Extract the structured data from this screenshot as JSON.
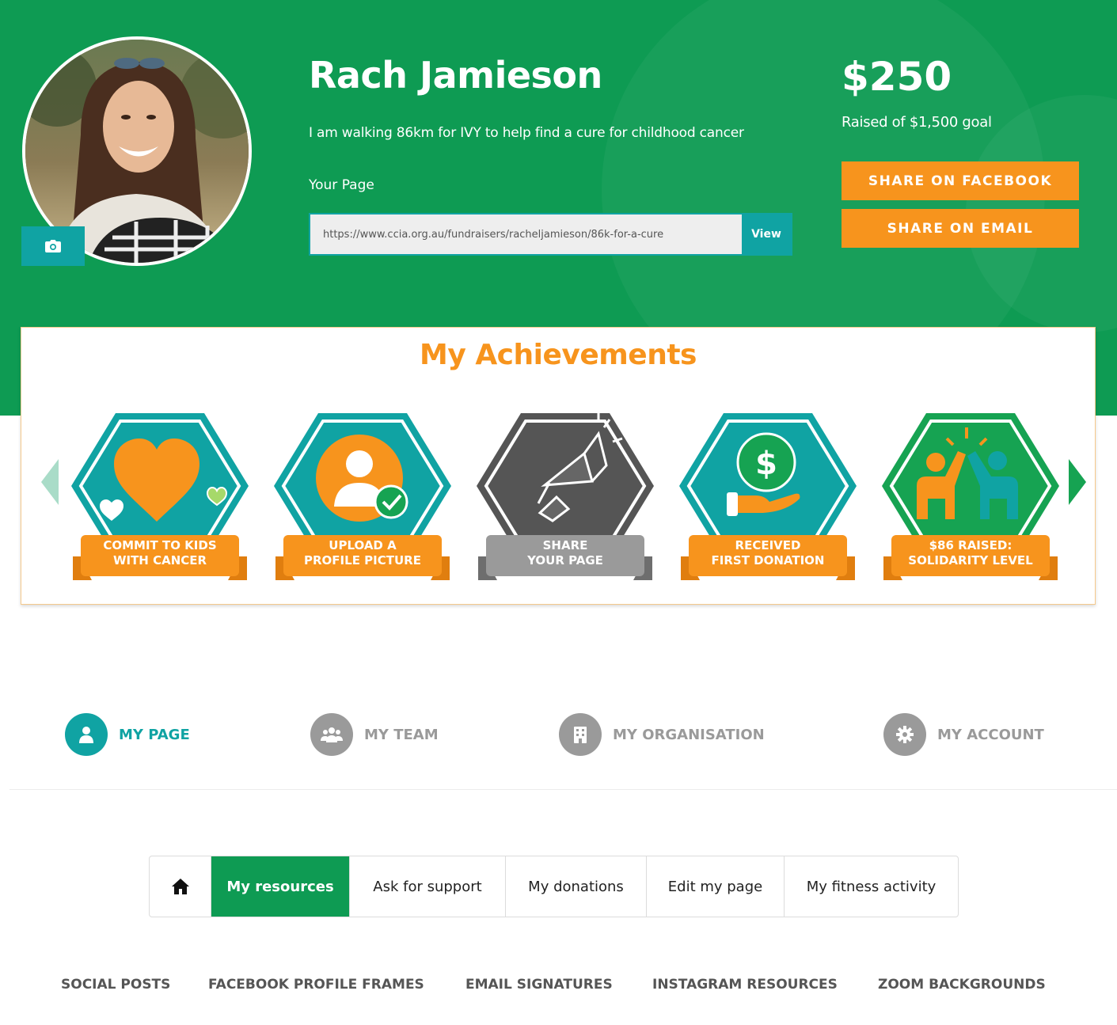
{
  "profile": {
    "name": "Rach Jamieson",
    "tagline": "I am walking 86km for IVY to help find a cure for childhood cancer",
    "your_page_label": "Your Page",
    "page_url": "https://www.ccia.org.au/fundraisers/racheljamieson/86k-for-a-cure",
    "view_label": "View"
  },
  "fundraising": {
    "raised": "$250",
    "goal_text": "Raised of $1,500 goal",
    "raised_fraction": 0.1667,
    "share_facebook_label": "SHARE ON FACEBOOK",
    "share_email_label": "SHARE ON EMAIL"
  },
  "achievements": {
    "title": "My Achievements",
    "badges": [
      {
        "line1": "COMMIT TO KIDS",
        "line2": "WITH CANCER",
        "icon": "heart-icon",
        "color": "#10a3a3",
        "achieved": true
      },
      {
        "line1": "UPLOAD A",
        "line2": "PROFILE PICTURE",
        "icon": "profile-check-icon",
        "color": "#10a3a3",
        "achieved": true
      },
      {
        "line1": "SHARE",
        "line2": "YOUR PAGE",
        "icon": "megaphone-icon",
        "color": "#555555",
        "achieved": false
      },
      {
        "line1": "RECEIVED",
        "line2": "FIRST DONATION",
        "icon": "dollar-hand-icon",
        "color": "#10a3a3",
        "achieved": true
      },
      {
        "line1": "$86 RAISED:",
        "line2": "SOLIDARITY LEVEL",
        "icon": "high-five-icon",
        "color": "#16a352",
        "achieved": true
      }
    ]
  },
  "dashboard_nav": [
    {
      "label": "MY PAGE",
      "icon": "person-icon",
      "active": true
    },
    {
      "label": "MY TEAM",
      "icon": "team-icon",
      "active": false
    },
    {
      "label": "MY ORGANISATION",
      "icon": "building-icon",
      "active": false
    },
    {
      "label": "MY ACCOUNT",
      "icon": "gear-icon",
      "active": false
    }
  ],
  "tabs": [
    {
      "label": "",
      "icon": "home-icon",
      "active": false
    },
    {
      "label": "My resources",
      "active": true
    },
    {
      "label": "Ask for support",
      "active": false
    },
    {
      "label": "My donations",
      "active": false
    },
    {
      "label": "Edit my page",
      "active": false
    },
    {
      "label": "My fitness activity",
      "active": false
    }
  ],
  "resource_links": [
    "SOCIAL POSTS",
    "FACEBOOK PROFILE FRAMES",
    "EMAIL SIGNATURES",
    "INSTAGRAM RESOURCES",
    "ZOOM BACKGROUNDS"
  ],
  "colors": {
    "brand_green": "#0e9b53",
    "teal": "#10a3a3",
    "orange": "#f7941d",
    "grey": "#9a9a9a"
  }
}
